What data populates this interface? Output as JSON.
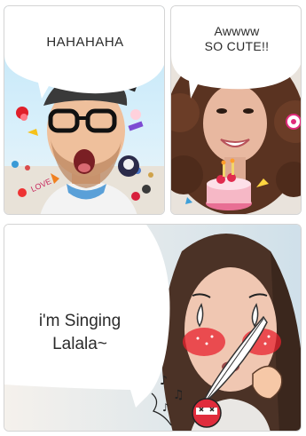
{
  "panels": [
    {
      "caption": "HAHAHAHA"
    },
    {
      "caption": "Awwww\nSO CUTE!!"
    },
    {
      "caption": "i'm Singing\nLalala~"
    }
  ]
}
